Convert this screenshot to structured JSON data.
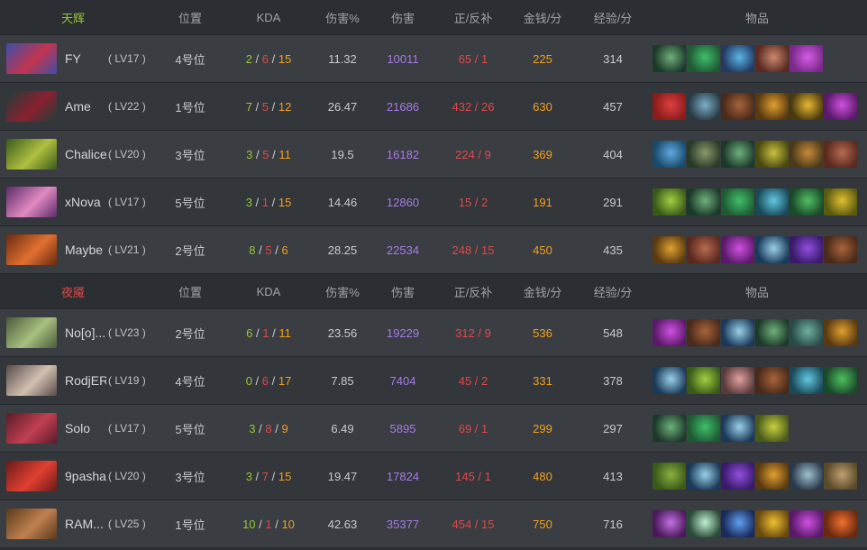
{
  "headers": {
    "position": "位置",
    "kda": "KDA",
    "damage_pct": "伤害%",
    "damage": "伤害",
    "last_hits": "正/反补",
    "gpm": "金钱/分",
    "xpm": "经验/分",
    "items": "物品"
  },
  "radiant": {
    "team_name": "天辉",
    "color": "#9ac734",
    "players": [
      {
        "name": "FY",
        "level": "( LV17 )",
        "position": "4号位",
        "kills": "2",
        "deaths": "6",
        "assists": "15",
        "damage_pct": "11.32",
        "damage": "10011",
        "last_hits": "65 / 1",
        "gpm": "225",
        "xpm": "314",
        "portrait": [
          "#3d4fa8",
          "#c2344f"
        ],
        "items": [
          [
            "#1c3a2a",
            "#6fb07c"
          ],
          [
            "#1f5a34",
            "#3fbf6a"
          ],
          [
            "#233a63",
            "#5ab4e6"
          ],
          [
            "#5c2a22",
            "#c88a6c"
          ],
          [
            "#7a2a8a",
            "#d65ce6"
          ]
        ]
      },
      {
        "name": "Ame",
        "level": "( LV22 )",
        "position": "1号位",
        "kills": "7",
        "deaths": "5",
        "assists": "12",
        "damage_pct": "26.47",
        "damage": "21686",
        "last_hits": "432 / 26",
        "gpm": "630",
        "xpm": "457",
        "portrait": [
          "#1f3f3a",
          "#8a2030"
        ],
        "items": [
          [
            "#8a1c1c",
            "#e04040"
          ],
          [
            "#2a3a44",
            "#7ab0c8"
          ],
          [
            "#4a2a1a",
            "#a8643a"
          ],
          [
            "#5a3a10",
            "#e0a030"
          ],
          [
            "#4a3a10",
            "#e8b830"
          ],
          [
            "#5a1a6a",
            "#d050e0"
          ]
        ]
      },
      {
        "name": "Chalice",
        "level": "( LV20 )",
        "position": "3号位",
        "kills": "3",
        "deaths": "5",
        "assists": "11",
        "damage_pct": "19.5",
        "damage": "16182",
        "last_hits": "224 / 9",
        "gpm": "369",
        "xpm": "404",
        "portrait": [
          "#3a5a1a",
          "#b0c040"
        ],
        "items": [
          [
            "#1a4a6a",
            "#60a8e0"
          ],
          [
            "#2a3a2a",
            "#8a9a6a"
          ],
          [
            "#1c3a2a",
            "#6fb07c"
          ],
          [
            "#4a4a10",
            "#c8c040"
          ],
          [
            "#4a3a1a",
            "#c88a3a"
          ],
          [
            "#5a2a20",
            "#b86a50"
          ]
        ]
      },
      {
        "name": "xNova",
        "level": "( LV17 )",
        "position": "5号位",
        "kills": "3",
        "deaths": "1",
        "assists": "15",
        "damage_pct": "14.46",
        "damage": "12860",
        "last_hits": "15 / 2",
        "gpm": "191",
        "xpm": "291",
        "portrait": [
          "#5a2a6a",
          "#e08ac0"
        ],
        "items": [
          [
            "#3a5a1a",
            "#a0d040"
          ],
          [
            "#1c3a2a",
            "#6fb07c"
          ],
          [
            "#1f5a34",
            "#3fbf6a"
          ],
          [
            "#1a4a5a",
            "#60c8e0"
          ],
          [
            "#1a4a2a",
            "#50c060"
          ],
          [
            "#5a5a10",
            "#e0c030"
          ]
        ]
      },
      {
        "name": "Maybe",
        "level": "( LV21 )",
        "position": "2号位",
        "kills": "8",
        "deaths": "5",
        "assists": "6",
        "damage_pct": "28.25",
        "damage": "22534",
        "last_hits": "248 / 15",
        "gpm": "450",
        "xpm": "435",
        "portrait": [
          "#6a2a10",
          "#e07030"
        ],
        "items": [
          [
            "#5a3a10",
            "#e0a030"
          ],
          [
            "#5a2a20",
            "#b86a50"
          ],
          [
            "#5a1a6a",
            "#d050e0"
          ],
          [
            "#1a3a5a",
            "#9ad0e8"
          ],
          [
            "#3a1a6a",
            "#9050e0"
          ],
          [
            "#4a2a1a",
            "#a8643a"
          ]
        ]
      }
    ]
  },
  "dire": {
    "team_name": "夜魇",
    "color": "#e0494a",
    "players": [
      {
        "name": "No[o]...",
        "level": "( LV23 )",
        "position": "2号位",
        "kills": "6",
        "deaths": "1",
        "assists": "11",
        "damage_pct": "23.56",
        "damage": "19229",
        "last_hits": "312 / 9",
        "gpm": "536",
        "xpm": "548",
        "portrait": [
          "#4a5a3a",
          "#a8c080"
        ],
        "items": [
          [
            "#5a1a6a",
            "#d050e0"
          ],
          [
            "#4a2a1a",
            "#a8643a"
          ],
          [
            "#1a3a5a",
            "#9ad0e8"
          ],
          [
            "#1c3a2a",
            "#6fb07c"
          ],
          [
            "#2a4a4a",
            "#70b0a0"
          ],
          [
            "#5a3a10",
            "#e0a030"
          ]
        ]
      },
      {
        "name": "RodjER",
        "level": "( LV19 )",
        "position": "4号位",
        "kills": "0",
        "deaths": "6",
        "assists": "17",
        "damage_pct": "7.85",
        "damage": "7404",
        "last_hits": "45 / 2",
        "gpm": "331",
        "xpm": "378",
        "portrait": [
          "#5a4a4a",
          "#d0c0b0"
        ],
        "items": [
          [
            "#1a3a5a",
            "#9ad0e8"
          ],
          [
            "#3a5a1a",
            "#a0d040"
          ],
          [
            "#5a3a3a",
            "#e0a0a0"
          ],
          [
            "#4a2a1a",
            "#a8643a"
          ],
          [
            "#1a4a5a",
            "#60c8e0"
          ],
          [
            "#1a4a2a",
            "#50c060"
          ]
        ]
      },
      {
        "name": "Solo",
        "level": "( LV17 )",
        "position": "5号位",
        "kills": "3",
        "deaths": "8",
        "assists": "9",
        "damage_pct": "6.49",
        "damage": "5895",
        "last_hits": "69 / 1",
        "gpm": "299",
        "xpm": "297",
        "portrait": [
          "#5a1a2a",
          "#c04050"
        ],
        "items": [
          [
            "#1c3a2a",
            "#6fb07c"
          ],
          [
            "#1f5a34",
            "#3fbf6a"
          ],
          [
            "#1a3a5a",
            "#9ad0e8"
          ],
          [
            "#4a5a1a",
            "#c8d040"
          ]
        ]
      },
      {
        "name": "9pasha",
        "level": "( LV20 )",
        "position": "3号位",
        "kills": "3",
        "deaths": "7",
        "assists": "15",
        "damage_pct": "19.47",
        "damage": "17824",
        "last_hits": "145 / 1",
        "gpm": "480",
        "xpm": "413",
        "portrait": [
          "#6a1a1a",
          "#e04030"
        ],
        "items": [
          [
            "#3a5a1a",
            "#8ab040"
          ],
          [
            "#1a3a5a",
            "#9ad0e8"
          ],
          [
            "#3a1a6a",
            "#9050e0"
          ],
          [
            "#5a3a10",
            "#e0a030"
          ],
          [
            "#2a3a4a",
            "#a0c0d0"
          ],
          [
            "#5a4a2a",
            "#c0a070"
          ]
        ]
      },
      {
        "name": "RAM...",
        "level": "( LV25 )",
        "position": "1号位",
        "kills": "10",
        "deaths": "1",
        "assists": "10",
        "damage_pct": "42.63",
        "damage": "35377",
        "last_hits": "454 / 15",
        "gpm": "750",
        "xpm": "716",
        "portrait": [
          "#5a3a1a",
          "#c08050"
        ],
        "items": [
          [
            "#4a1a5a",
            "#c070e0"
          ],
          [
            "#2a4a3a",
            "#c0f0d0"
          ],
          [
            "#1a2a5a",
            "#60a0f0"
          ],
          [
            "#6a4a10",
            "#f0c030"
          ],
          [
            "#5a1a6a",
            "#d050e0"
          ],
          [
            "#6a2a10",
            "#f07030"
          ]
        ]
      }
    ]
  }
}
